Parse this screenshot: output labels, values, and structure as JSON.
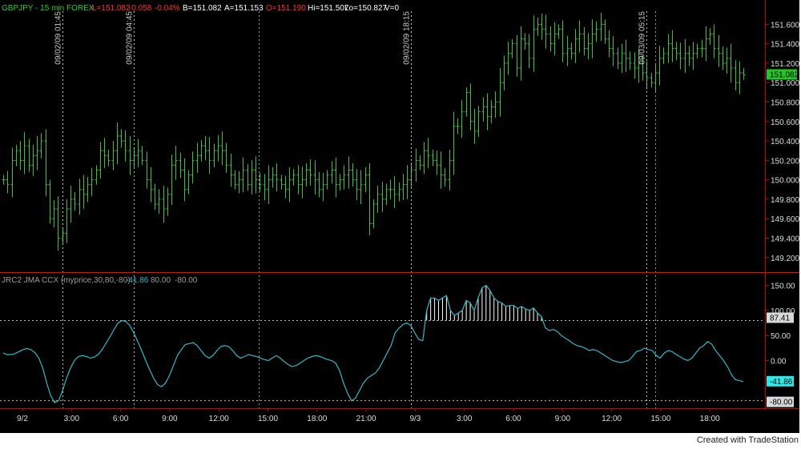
{
  "header": {
    "symbol_info": "GBPJPY - 15 min  FOREX",
    "last": "L=151.082",
    "change": "-0.058",
    "pct_change": "-0.04%",
    "bid": "B=151.082",
    "ask": "A=151.153",
    "open": "O=151.190",
    "high": "Hi=151.507",
    "low": "Lo=150.827",
    "volume": "V=0"
  },
  "indicator_header": {
    "name": "JRC2 JMA CCX  (myprice,30,80,-80)",
    "value": "-41.86",
    "upper": "80.00",
    "lower": "-80.00"
  },
  "footer": {
    "credit": "Created with TradeStation"
  },
  "colors": {
    "background": "#000000",
    "bars": "#3fbf3f",
    "indicator_line": "#35b8c7",
    "last_price_tag": "#27c427",
    "indicator_tag": "#2ee8e8",
    "header_green": "#33cc33",
    "header_red": "#ff3333",
    "axis_line": "#cc0000",
    "panel_divider": "#ff0000"
  },
  "chart_data": [
    {
      "type": "ohlc",
      "title": "GBPJPY - 15 min  FOREX",
      "y_ticks": [
        "151.600",
        "151.400",
        "151.200",
        "151.000",
        "150.800",
        "150.600",
        "150.400",
        "150.200",
        "150.000",
        "149.800",
        "149.600",
        "149.400",
        "149.200"
      ],
      "ylim": [
        149.05,
        151.85
      ],
      "last_price_label": "151.082",
      "x_ticks": [
        "9/2",
        "3:00",
        "6:00",
        "9:00",
        "12:00",
        "15:00",
        "18:00",
        "21:00",
        "9/3",
        "3:00",
        "6:00",
        "9:00",
        "12:00",
        "15:00",
        "18:00"
      ],
      "vertical_markers": [
        "09/02/09 01:45",
        "09/02/09 04:45",
        "09/02/09 18:15",
        "09/03/09 05:15"
      ],
      "series": [
        {
          "values": [
            150.0,
            149.95,
            150.2,
            150.3,
            150.2,
            150.35,
            150.15,
            150.25,
            150.3,
            150.4,
            149.95,
            149.6,
            149.7,
            149.4,
            149.45,
            149.7,
            149.8,
            149.75,
            149.9,
            149.85,
            149.95,
            150.0,
            150.1,
            150.3,
            150.25,
            150.2,
            150.3,
            150.45,
            150.4,
            150.3,
            150.2,
            150.25,
            150.3,
            150.2,
            150.0,
            149.9,
            149.75,
            149.8,
            149.7,
            149.85,
            150.15,
            150.2,
            150.1,
            149.9,
            150.05,
            150.2,
            150.25,
            150.35,
            150.3,
            150.2,
            150.3,
            150.35,
            150.3,
            150.15,
            150.05,
            149.95,
            150.0,
            150.1,
            149.95,
            150.1,
            150.0,
            149.95,
            149.9,
            150.0,
            150.05,
            150.0,
            149.95,
            149.9,
            150.0,
            150.05,
            149.95,
            150.0,
            150.1,
            150.05,
            150.0,
            149.9,
            149.95,
            150.05,
            150.1,
            149.95,
            150.0,
            150.05,
            150.1,
            150.0,
            149.9,
            149.95,
            150.05,
            149.55,
            149.75,
            149.85,
            149.8,
            149.9,
            149.9,
            149.85,
            149.9,
            149.95,
            150.0,
            150.1,
            150.2,
            150.15,
            150.3,
            150.25,
            150.2,
            150.15,
            150.05,
            150.0,
            150.2,
            150.55,
            150.55,
            150.7,
            150.9,
            150.6,
            150.5,
            150.7,
            150.75,
            150.65,
            150.75,
            150.8,
            151.0,
            151.2,
            151.3,
            151.4,
            151.15,
            151.45,
            151.4,
            151.25,
            151.55,
            151.6,
            151.55,
            151.5,
            151.4,
            151.5,
            151.55,
            151.3,
            151.35,
            151.3,
            151.45,
            151.5,
            151.35,
            151.4,
            151.5,
            151.55,
            151.6,
            151.45,
            151.35,
            151.3,
            151.2,
            151.3,
            151.25,
            151.2,
            151.15,
            151.2,
            151.1,
            151.05,
            151.0,
            151.1,
            151.25,
            151.3,
            151.4,
            151.35,
            151.3,
            151.25,
            151.3,
            151.25,
            151.3,
            151.35,
            151.35,
            151.45,
            151.5,
            151.35,
            151.3,
            151.2,
            151.25,
            151.15,
            151.0,
            151.1,
            151.08
          ]
        }
      ]
    },
    {
      "type": "line",
      "title": "JRC2 JMA CCX  (myprice,30,80,-80)",
      "y_ticks": [
        "150.00",
        "100.00",
        "50.00",
        "0.00"
      ],
      "ylim": [
        -95,
        175
      ],
      "levels": [
        "80.00",
        "-80.00"
      ],
      "level_values": [
        80,
        -80
      ],
      "last_value_label": "-41.86",
      "upper_tag": "87.41",
      "lower_tag": "-80.00",
      "series": [
        {
          "values": [
            15,
            12,
            12,
            14,
            18,
            22,
            24,
            22,
            16,
            5,
            -15,
            -45,
            -70,
            -84,
            -80,
            -60,
            -35,
            -15,
            0,
            8,
            10,
            8,
            5,
            7,
            12,
            22,
            35,
            48,
            62,
            75,
            80,
            78,
            70,
            55,
            38,
            20,
            0,
            -18,
            -35,
            -48,
            -52,
            -45,
            -30,
            -10,
            10,
            22,
            32,
            34,
            36,
            30,
            20,
            10,
            5,
            10,
            20,
            28,
            30,
            28,
            20,
            10,
            5,
            8,
            12,
            10,
            8,
            5,
            2,
            0,
            5,
            10,
            5,
            -2,
            -8,
            -12,
            -10,
            -5,
            0,
            5,
            8,
            10,
            8,
            5,
            2,
            0,
            -5,
            -20,
            -45,
            -65,
            -80,
            -75,
            -60,
            -45,
            -35,
            -30,
            -25,
            -15,
            0,
            15,
            30,
            55,
            65,
            72,
            75,
            70,
            55,
            42,
            40,
            100,
            125,
            125,
            120,
            125,
            130,
            100,
            90,
            95,
            100,
            120,
            115,
            100,
            125,
            145,
            150,
            140,
            125,
            118,
            115,
            108,
            110,
            110,
            104,
            108,
            103,
            100,
            105,
            95,
            88,
            65,
            60,
            62,
            58,
            50,
            45,
            40,
            34,
            30,
            28,
            25,
            20,
            22,
            20,
            15,
            10,
            5,
            0,
            -2,
            -4,
            -2,
            0,
            8,
            18,
            20,
            25,
            22,
            20,
            10,
            5,
            15,
            20,
            18,
            12,
            8,
            3,
            0,
            5,
            15,
            25,
            30,
            38,
            33,
            20,
            10,
            0,
            -12,
            -28,
            -38,
            -40,
            -42
          ]
        }
      ]
    }
  ]
}
